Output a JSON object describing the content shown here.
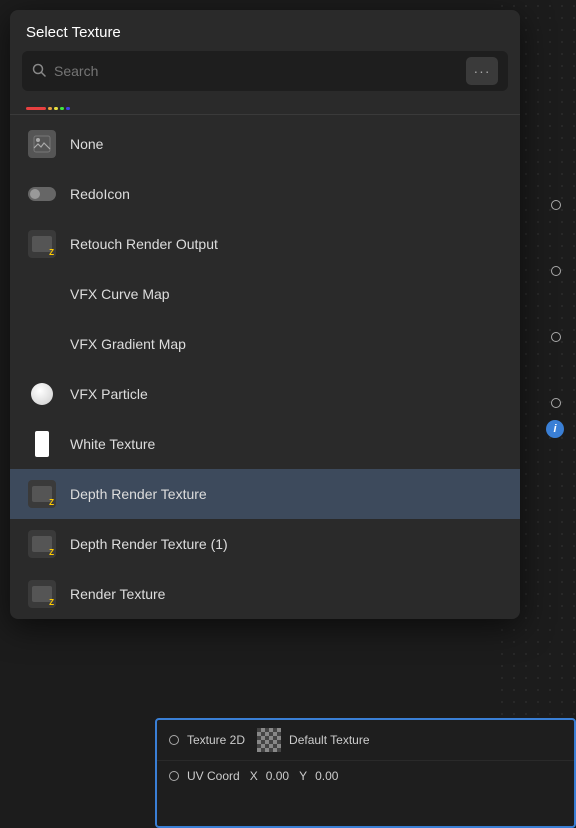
{
  "panel": {
    "title": "Select Texture",
    "search": {
      "placeholder": "Search",
      "value": ""
    },
    "more_button_label": "···"
  },
  "color_accent": [
    {
      "color": "#e84040",
      "width": 20
    },
    {
      "color": "#e8a040",
      "width": 12
    },
    {
      "color": "#e8e040",
      "width": 10
    },
    {
      "color": "#40e840",
      "width": 12
    },
    {
      "color": "#4040e8",
      "width": 10
    }
  ],
  "items": [
    {
      "id": "none",
      "label": "None",
      "icon_type": "image",
      "selected": false
    },
    {
      "id": "redolcon",
      "label": "RedoIcon",
      "icon_type": "redolcon",
      "selected": false
    },
    {
      "id": "retouch",
      "label": "Retouch Render Output",
      "icon_type": "render",
      "selected": false
    },
    {
      "id": "vfx-curve",
      "label": "VFX Curve Map",
      "icon_type": "none",
      "selected": false
    },
    {
      "id": "vfx-gradient",
      "label": "VFX Gradient Map",
      "icon_type": "none",
      "selected": false
    },
    {
      "id": "vfx-particle",
      "label": "VFX Particle",
      "icon_type": "circle_white",
      "selected": false
    },
    {
      "id": "white-texture",
      "label": "White Texture",
      "icon_type": "rect_white",
      "selected": false
    },
    {
      "id": "depth-render",
      "label": "Depth Render Texture",
      "icon_type": "render",
      "selected": true
    },
    {
      "id": "depth-render-1",
      "label": "Depth Render Texture (1)",
      "icon_type": "render",
      "selected": false
    },
    {
      "id": "render-texture",
      "label": "Render Texture",
      "icon_type": "render",
      "selected": false
    }
  ],
  "bottom_panel": {
    "row1": {
      "circle": true,
      "label": "Texture 2D",
      "texture_name": "Default Texture"
    },
    "row2": {
      "circle": true,
      "label": "UV Coord",
      "x_label": "X",
      "x_value": "0.00",
      "y_label": "Y",
      "y_value": "0.00"
    }
  }
}
